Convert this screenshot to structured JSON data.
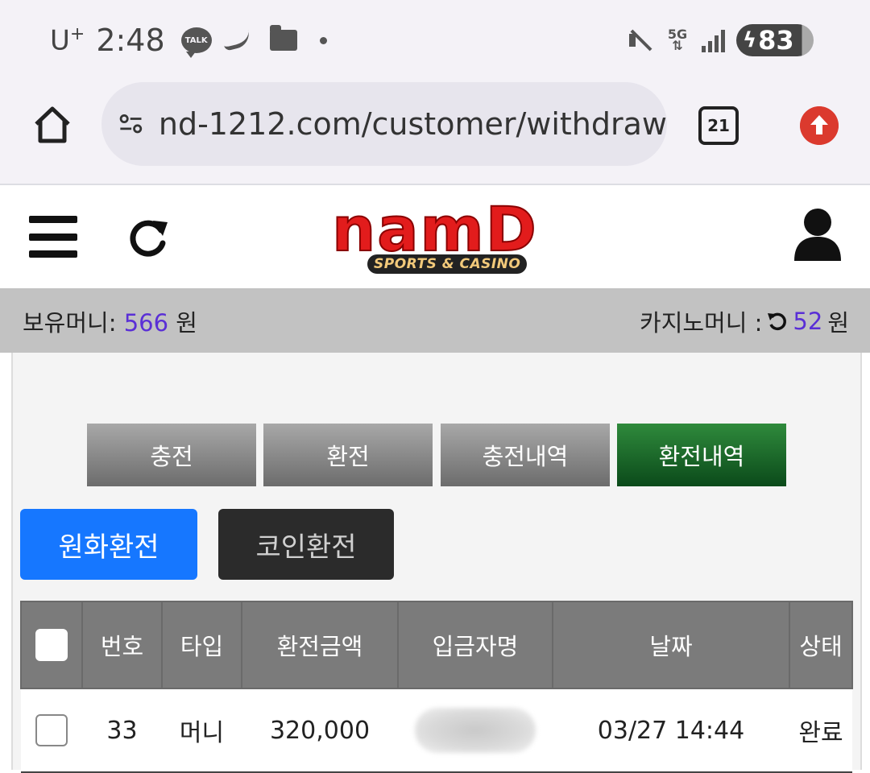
{
  "status_bar": {
    "carrier": "U",
    "carrier_sup": "+",
    "time": "2:48",
    "talk_label": "TALK",
    "network": "5G",
    "battery": "83",
    "icons": [
      "kakaotalk-icon",
      "nike-icon",
      "folder-icon",
      "dot-icon",
      "mute-icon",
      "5g-icon",
      "signal-icon",
      "battery-icon"
    ]
  },
  "browser": {
    "url": "nd-1212.com/customer/withdraw",
    "tab_count": "21",
    "icons": [
      "home-icon",
      "site-settings-icon",
      "tabs-icon",
      "upgrade-icon"
    ]
  },
  "header": {
    "logo_text": "namD",
    "logo_sub": "SPORTS & CASINO",
    "icons": [
      "menu-icon",
      "refresh-icon",
      "user-icon"
    ]
  },
  "money": {
    "hold_label": "보유머니:",
    "hold_value": "566",
    "hold_unit": "원",
    "casino_label": "카지노머니 :",
    "casino_value": "52",
    "casino_unit": "원"
  },
  "tabs": [
    {
      "label": "충전"
    },
    {
      "label": "환전"
    },
    {
      "label": "충전내역"
    },
    {
      "label": "환전내역"
    }
  ],
  "sub_buttons": {
    "krw": "원화환전",
    "coin": "코인환전"
  },
  "table": {
    "headers": [
      "번호",
      "타입",
      "환전금액",
      "입금자명",
      "날짜",
      "상태"
    ],
    "rows": [
      {
        "no": "33",
        "type": "머니",
        "amount": "320,000",
        "name": "",
        "date": "03/27 14:44",
        "status": "완료"
      }
    ]
  },
  "colors": {
    "accent_blue": "#1677ff",
    "active_tab_green": "#1b6b2a",
    "money_value": "#5a2fd6",
    "brand_red": "#e21c1c"
  }
}
